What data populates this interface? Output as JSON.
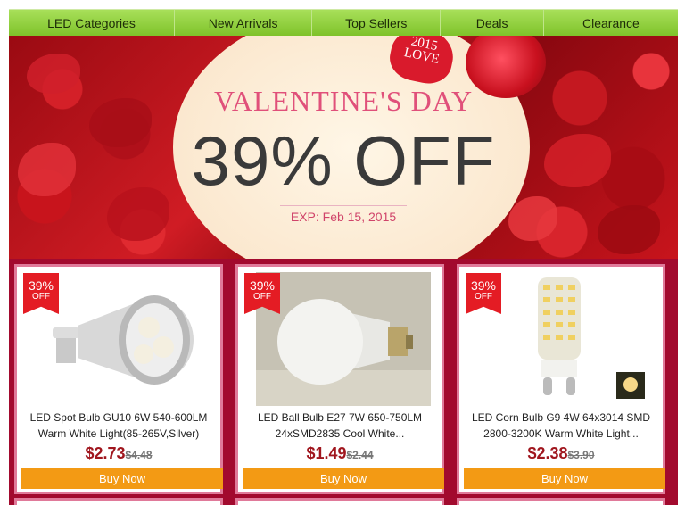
{
  "nav": {
    "items": [
      "LED Categories",
      "New Arrivals",
      "Top Sellers",
      "Deals",
      "Clearance"
    ]
  },
  "banner": {
    "title": "VALENTINE'S DAY",
    "discount": "39% OFF",
    "expiry": "EXP: Feb 15, 2015",
    "heart_line1": "2015",
    "heart_line2": "LOVE"
  },
  "products": [
    {
      "badge_pct": "39%",
      "badge_off": "OFF",
      "name": "LED Spot Bulb GU10 6W 540-600LM Warm White Light(85-265V,Silver)",
      "price": "$2.73",
      "old_price": "$4.48",
      "button": "Buy Now",
      "icon": "spot-bulb-image"
    },
    {
      "badge_pct": "39%",
      "badge_off": "OFF",
      "name": "LED Ball Bulb E27 7W 650-750LM 24xSMD2835 Cool White...",
      "price": "$1.49",
      "old_price": "$2.44",
      "button": "Buy Now",
      "icon": "ball-bulb-image"
    },
    {
      "badge_pct": "39%",
      "badge_off": "OFF",
      "name": "LED Corn Bulb G9 4W 64x3014 SMD 2800-3200K Warm White Light...",
      "price": "$2.38",
      "old_price": "$3.90",
      "button": "Buy Now",
      "icon": "corn-bulb-image"
    }
  ],
  "colors": {
    "nav": "#8fd13a",
    "band": "#a20a2e",
    "price": "#a0161e",
    "button": "#f39a14",
    "badge": "#e41c24"
  }
}
